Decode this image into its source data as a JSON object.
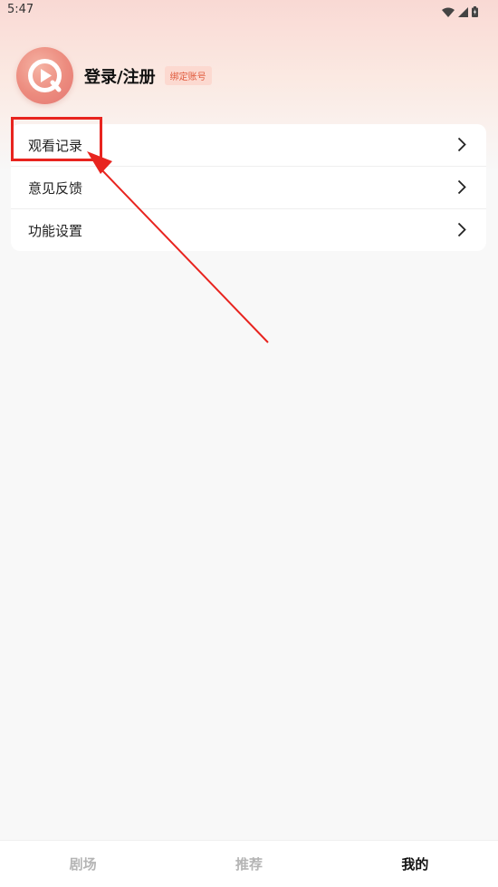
{
  "status_bar": {
    "time": "5:47",
    "icons": [
      "wifi-icon",
      "signal-icon",
      "battery-icon"
    ]
  },
  "profile": {
    "login_label": "登录/注册",
    "bind_badge": "绑定账号",
    "avatar_icon": "play-logo-icon"
  },
  "menu": {
    "items": [
      {
        "label": "观看记录",
        "icon": "chevron-right-icon"
      },
      {
        "label": "意见反馈",
        "icon": "chevron-right-icon"
      },
      {
        "label": "功能设置",
        "icon": "chevron-right-icon"
      }
    ]
  },
  "bottom_nav": {
    "tabs": [
      {
        "label": "剧场",
        "active": false
      },
      {
        "label": "推荐",
        "active": false
      },
      {
        "label": "我的",
        "active": true
      }
    ]
  },
  "colors": {
    "accent": "#e8241f",
    "badge_text": "#e05a3c",
    "badge_bg": "#fcd9d0",
    "header_gradient_top": "#f9d9d4"
  }
}
